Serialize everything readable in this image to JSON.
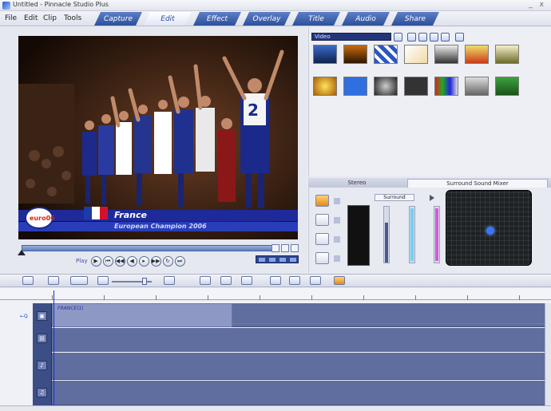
{
  "window": {
    "title": "Untitled - Pinnacle Studio Plus",
    "min_glyph": "_",
    "close_glyph": "x"
  },
  "menu": {
    "items": [
      "File",
      "Edit",
      "Clip",
      "Tools"
    ]
  },
  "mode_tabs": [
    "Capture",
    "Edit",
    "Effect",
    "Overlay",
    "Title",
    "Audio",
    "Share"
  ],
  "preview": {
    "overlay_country": "France",
    "overlay_caption": "European Champion 2006",
    "overlay_logo": "euro06",
    "transport_label": "Play"
  },
  "library": {
    "dropdown_value": "Video"
  },
  "audio": {
    "tabs": [
      "Stereo",
      "Surround Sound Mixer"
    ],
    "surround_label": "Surround",
    "colors": {
      "speaker_glow": "#3a75ff",
      "meter": "#111111"
    }
  },
  "timeline": {
    "clip_title": "FRANCE(1)",
    "marker_label": "←Q",
    "track_icons": [
      "video-track-icon",
      "overlay-track-icon",
      "audio-track-icon",
      "music-track-icon"
    ]
  },
  "colors": {
    "accent": "#2c4f9a",
    "track": "#5f6e9e",
    "playline": "#1c2ad8"
  }
}
